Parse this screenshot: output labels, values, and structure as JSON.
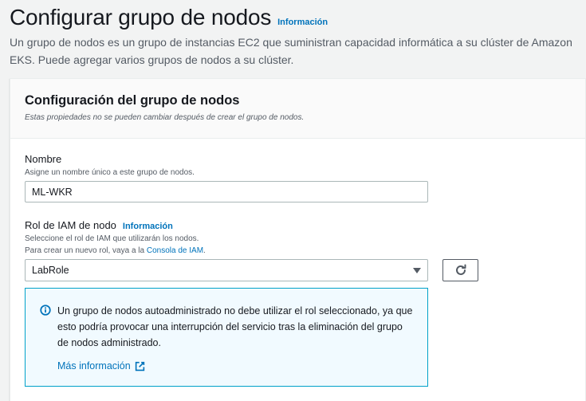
{
  "header": {
    "title": "Configurar grupo de nodos",
    "info_link": "Información",
    "description": "Un grupo de nodos es un grupo de instancias EC2 que suministran capacidad informática a su clúster de Amazon EKS. Puede agregar varios grupos de nodos a su clúster."
  },
  "panel": {
    "title": "Configuración del grupo de nodos",
    "subtitle": "Estas propiedades no se pueden cambiar después de crear el grupo de nodos."
  },
  "name_field": {
    "label": "Nombre",
    "description": "Asigne un nombre único a este grupo de nodos.",
    "value": "ML-WKR"
  },
  "role_field": {
    "label": "Rol de IAM de nodo",
    "info_link": "Información",
    "description": "Seleccione el rol de IAM que utilizarán los nodos.",
    "hint_prefix": "Para crear un nuevo rol, vaya a la ",
    "hint_link": "Consola de IAM",
    "hint_suffix": ".",
    "selected": "LabRole"
  },
  "alert": {
    "text": "Un grupo de nodos autoadministrado no debe utilizar el rol seleccionado, ya que esto podría provocar una interrupción del servicio tras la eliminación del grupo de nodos administrado.",
    "link": "Más información"
  },
  "colors": {
    "link": "#0073bb",
    "info_border": "#00a1c9",
    "info_bg": "#f1faff"
  },
  "icons": [
    "info-icon",
    "refresh-icon",
    "external-link-icon",
    "caret-down-icon"
  ]
}
